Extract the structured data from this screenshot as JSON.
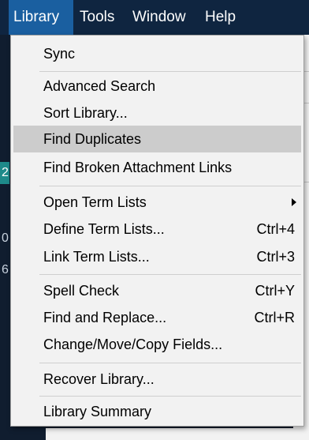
{
  "menubar": {
    "items": [
      "Library",
      "Tools",
      "Window",
      "Help"
    ],
    "active": "Library"
  },
  "background": {
    "glyphs": [
      "2",
      "0",
      "6"
    ]
  },
  "menu": {
    "items": [
      {
        "label": "Sync",
        "shortcut": ""
      },
      {
        "label": "Advanced Search",
        "shortcut": ""
      },
      {
        "label": "Sort Library...",
        "shortcut": ""
      },
      {
        "label": "Find Duplicates",
        "shortcut": "",
        "highlighted": true
      },
      {
        "label": "Find Broken Attachment Links",
        "shortcut": ""
      },
      {
        "label": "Open Term Lists",
        "shortcut": "",
        "submenu": true
      },
      {
        "label": "Define Term Lists...",
        "shortcut": "Ctrl+4"
      },
      {
        "label": "Link Term Lists...",
        "shortcut": "Ctrl+3"
      },
      {
        "label": "Spell Check",
        "shortcut": "Ctrl+Y"
      },
      {
        "label": "Find and Replace...",
        "shortcut": "Ctrl+R"
      },
      {
        "label": "Change/Move/Copy Fields...",
        "shortcut": ""
      },
      {
        "label": "Recover Library...",
        "shortcut": ""
      },
      {
        "label": "Library Summary",
        "shortcut": ""
      }
    ],
    "highlight_color": "#cccccc",
    "menubar_active_color": "#1a5fa0",
    "menubar_color": "#0f2540"
  }
}
